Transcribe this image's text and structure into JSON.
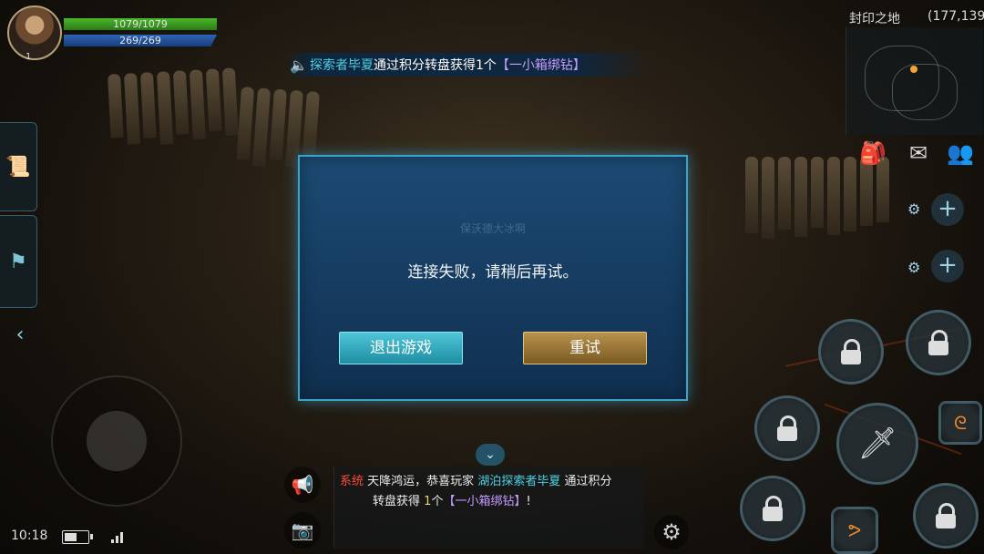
{
  "player": {
    "hp": "1079/1079",
    "mp": "269/269",
    "level": "1"
  },
  "marquee": {
    "name": "探索者毕夏",
    "text": "通过积分转盘获得1个",
    "item": "【一小箱绑钻】"
  },
  "location": {
    "map_name": "封印之地",
    "coords": "(177,139)"
  },
  "dialog": {
    "ghost_text": "保沃德大冰啊",
    "message": "连接失败，请稍后再试。",
    "exit_label": "退出游戏",
    "retry_label": "重试"
  },
  "chat": {
    "tag": "系统",
    "text1": "天降鸿运，恭喜玩家",
    "player": "湖泊探索者毕夏",
    "text2": "通过积分",
    "text3": "转盘获得",
    "count": "1",
    "unit": "个",
    "item": "【一小箱绑钻】",
    "end": "!"
  },
  "status": {
    "time": "10:18",
    "battery_level": 0.6
  },
  "icons": {
    "speaker": "speaker-icon",
    "bag": "bag-icon",
    "mail": "mail-icon",
    "team": "team-icon",
    "megaphone": "megaphone-icon",
    "camera": "camera-icon",
    "settings": "gear-icon",
    "sword": "sword-icon"
  },
  "colors": {
    "dialog_border": "#3aa3c8",
    "exit_button": "#1f8ea3",
    "retry_button": "#b8924c"
  }
}
